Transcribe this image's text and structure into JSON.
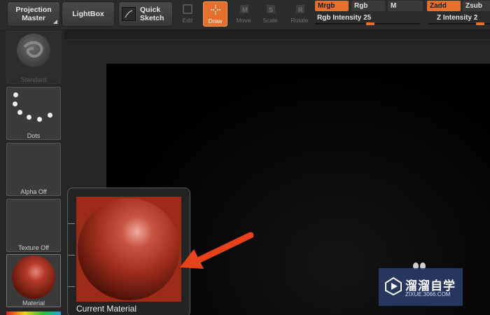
{
  "toolbar": {
    "projection_master": [
      "Projection",
      "Master"
    ],
    "lightbox": "LightBox",
    "quick_sketch": [
      "Quick",
      "Sketch"
    ],
    "tools": {
      "edit": "Edit",
      "draw": "Draw",
      "move": "Move",
      "scale": "Scale",
      "rotate": "Rotate"
    },
    "mrgb": "Mrgb",
    "rgb": "Rgb",
    "m": "M",
    "zadd": "Zadd",
    "zsub": "Zsub",
    "rgb_intensity_label": "Rgb Intensity 25",
    "z_intensity_label": "Z Intensity 2"
  },
  "shelf": {
    "brush": "Standard",
    "stroke": "Dots",
    "alpha": "Alpha Off",
    "texture": "Texture Off",
    "material": "Material"
  },
  "popup": {
    "title": "Current Material"
  },
  "watermark": {
    "name": "溜溜自学",
    "site": "ZIXUE.3066.COM"
  },
  "colors": {
    "accent": "#e4702b",
    "material_red": "#a02819",
    "arrow": "#e8421c"
  }
}
